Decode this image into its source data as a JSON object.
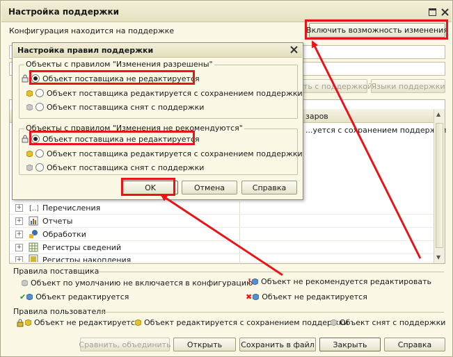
{
  "window": {
    "title": "Настройка поддержки"
  },
  "top": {
    "status_text": "Конфигурация находится на поддержке",
    "enable_button": "Включить возможность изменения"
  },
  "right_buttons": {
    "compare_support": "...ять с поддержкой",
    "support_languages": "Языки поддержки"
  },
  "grid": {
    "col_header_partial": "заров",
    "partial_row_text": "...уется с сохранением поддержки",
    "rows": [
      {
        "label": "Перечисления",
        "icon": "enum-icon"
      },
      {
        "label": "Отчеты",
        "icon": "report-icon"
      },
      {
        "label": "Обработки",
        "icon": "processing-icon"
      },
      {
        "label": "Регистры сведений",
        "icon": "info-register-icon"
      },
      {
        "label": "Регистры накопления",
        "icon": "accumulation-register-icon"
      }
    ]
  },
  "vendor_rules": {
    "title": "Правила поставщика",
    "items": [
      "Объект по умолчанию не включается в конфигурацию",
      "Объект не рекомендуется редактировать",
      "Объект редактируется",
      "Объект не редактируется"
    ]
  },
  "user_rules": {
    "title": "Правила пользователя",
    "items": [
      "Объект не редактируется",
      "Объект редактируется с сохранением поддержки",
      "Объект снят с поддержки"
    ]
  },
  "bottom_buttons": {
    "compare": "Сравнить, объединить",
    "open": "Открыть",
    "save_file": "Сохранить в файл",
    "close": "Закрыть",
    "help": "Справка"
  },
  "dialog": {
    "title": "Настройка правил поддержки",
    "group1": {
      "legend": "Объекты с правилом \"Изменения разрешены\"",
      "options": [
        "Объект поставщика не редактируется",
        "Объект поставщика редактируется с сохранением поддержки",
        "Объект поставщика снят с поддержки"
      ],
      "selected": 0
    },
    "group2": {
      "legend": "Объекты с правилом \"Изменения не рекомендуются\"",
      "options": [
        "Объект поставщика не редактируется",
        "Объект поставщика редактируется с сохранением поддержки",
        "Объект поставщика снят с поддержки"
      ],
      "selected": 0
    },
    "ok": "OK",
    "cancel": "Отмена",
    "help": "Справка"
  },
  "colors": {
    "highlight": "#e8141a",
    "window_bg": "#fbf8e6"
  }
}
